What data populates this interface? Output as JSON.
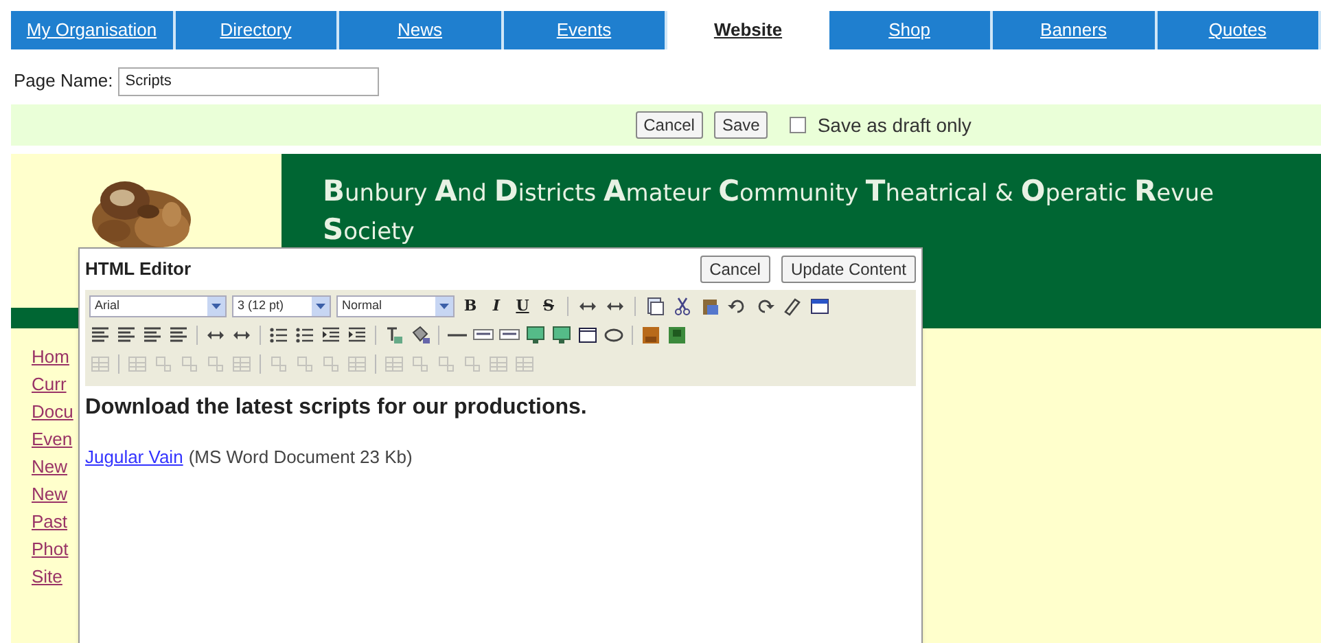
{
  "tabs": [
    {
      "label": "My Organisation",
      "selected": false
    },
    {
      "label": "Directory",
      "selected": false
    },
    {
      "label": "News",
      "selected": false
    },
    {
      "label": "Events",
      "selected": false
    },
    {
      "label": "Website",
      "selected": true
    },
    {
      "label": "Shop",
      "selected": false
    },
    {
      "label": "Banners",
      "selected": false
    },
    {
      "label": "Quotes",
      "selected": false
    }
  ],
  "page_name": {
    "label": "Page Name:",
    "value": "Scripts"
  },
  "action_bar": {
    "buttons": [
      "Cancel",
      "Save"
    ],
    "draft": {
      "label": "Save as draft only",
      "checked": false
    }
  },
  "site": {
    "title": "**B**unbury **A**nd **D**istricts **A**mateur **C**ommunity **T**heatrical & **O**peratic **R**evue **S**ociety",
    "nav_links": [
      "Hom",
      "Curr",
      "Docu",
      "Even",
      "New",
      "New",
      "Past",
      "Phot",
      "Site"
    ]
  },
  "editor": {
    "title": "HTML Editor",
    "buttons": [
      "Cancel",
      "Update Content"
    ],
    "font": "Arial",
    "size": "3 (12 pt)",
    "format": "Normal",
    "style_buttons": [
      "B",
      "I",
      "U",
      "S"
    ],
    "heading": "Download the latest scripts for our productions.",
    "link": "Jugular Vain",
    "link_note": "(MS Word Document 23 Kb)"
  }
}
